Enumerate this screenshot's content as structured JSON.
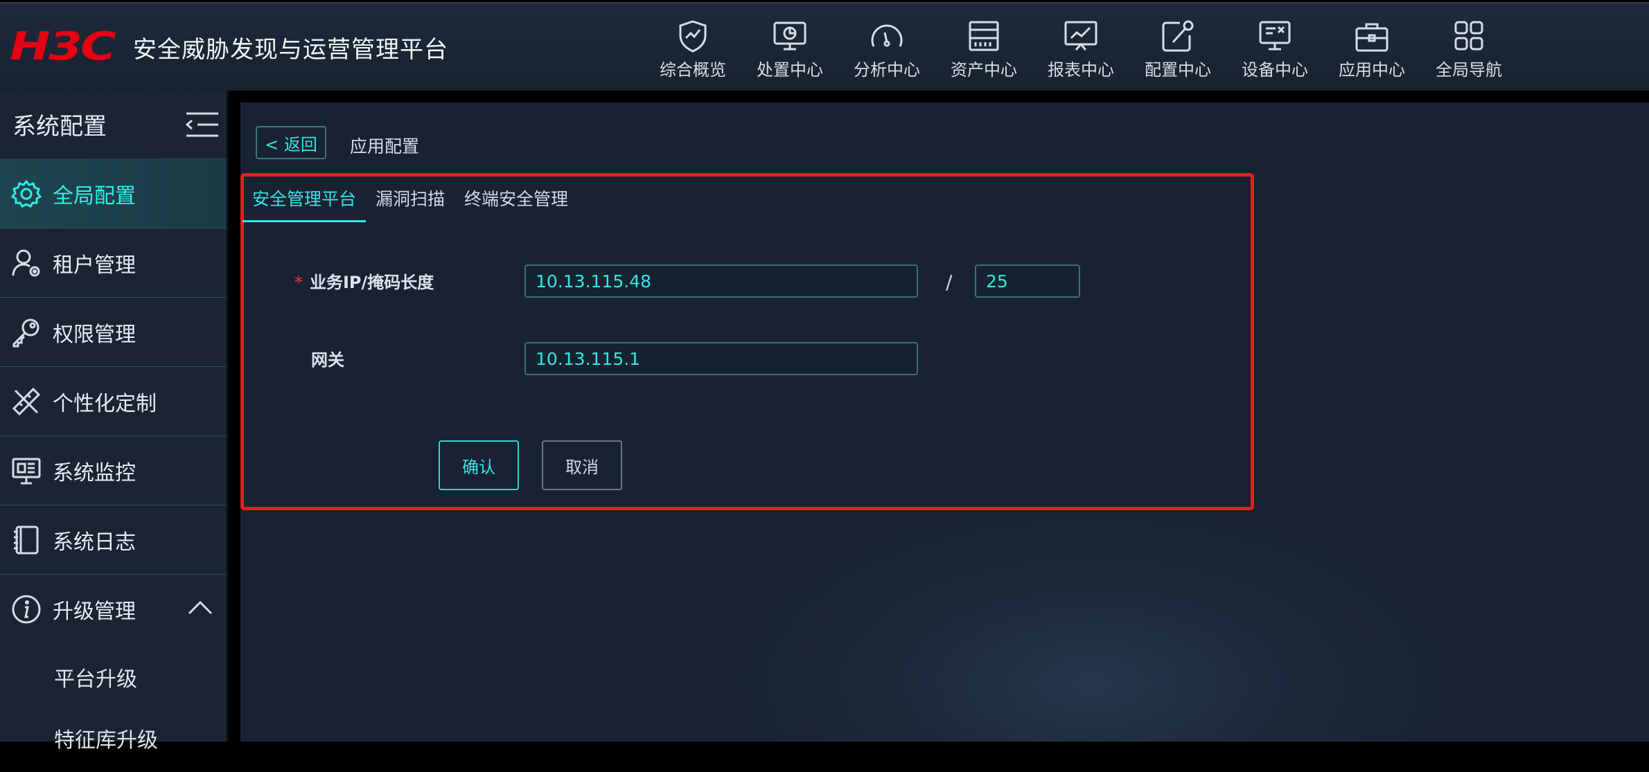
{
  "header": {
    "logo_text": "H3C",
    "title": "安全威胁发现与运营管理平台",
    "nav": [
      {
        "label": "综合概览",
        "icon": "shield-check-icon"
      },
      {
        "label": "处置中心",
        "icon": "monitor-chart-icon"
      },
      {
        "label": "分析中心",
        "icon": "gauge-icon"
      },
      {
        "label": "资产中心",
        "icon": "server-rack-icon"
      },
      {
        "label": "报表中心",
        "icon": "line-chart-board-icon"
      },
      {
        "label": "配置中心",
        "icon": "wrench-edit-icon"
      },
      {
        "label": "设备中心",
        "icon": "device-monitor-icon"
      },
      {
        "label": "应用中心",
        "icon": "toolbox-icon"
      },
      {
        "label": "全局导航",
        "icon": "grid-icon"
      }
    ]
  },
  "sidebar": {
    "title": "系统配置",
    "items": [
      {
        "label": "全局配置",
        "icon": "gear-icon",
        "active": true
      },
      {
        "label": "租户管理",
        "icon": "tenant-user-icon"
      },
      {
        "label": "权限管理",
        "icon": "key-icon"
      },
      {
        "label": "个性化定制",
        "icon": "ruler-pencil-icon"
      },
      {
        "label": "系统监控",
        "icon": "monitor-network-icon"
      },
      {
        "label": "系统日志",
        "icon": "notebook-icon"
      },
      {
        "label": "升级管理",
        "icon": "info-circle-icon",
        "expanded": true
      }
    ],
    "subitems": [
      {
        "label": "平台升级"
      },
      {
        "label": "特征库升级"
      }
    ]
  },
  "main": {
    "back_label": "< 返回",
    "breadcrumb": "应用配置",
    "tabs": [
      {
        "label": "安全管理平台",
        "active": true
      },
      {
        "label": "漏洞扫描"
      },
      {
        "label": "终端安全管理"
      }
    ],
    "form": {
      "ip_label": "业务IP/掩码长度",
      "ip_required_mark": "*",
      "ip_value": "10.13.115.48",
      "separator": "/",
      "mask_value": "25",
      "gateway_label": "网关",
      "gateway_value": "10.13.115.1",
      "confirm_label": "确认",
      "cancel_label": "取消"
    }
  },
  "colors": {
    "accent": "#32e7e2",
    "highlight_border": "#ee1c1c",
    "brand_red": "#e60012"
  }
}
